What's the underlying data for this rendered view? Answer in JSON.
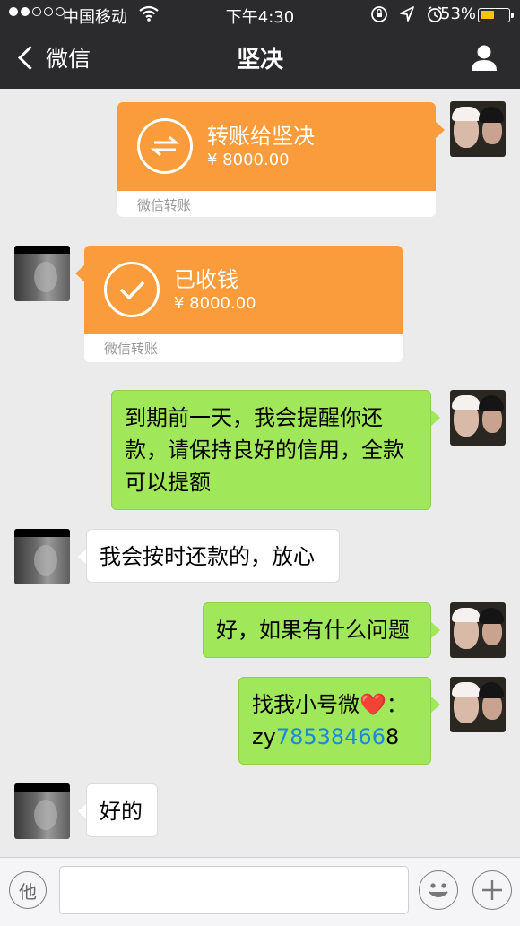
{
  "status_bar": {
    "carrier": "中国移动",
    "time": "下午4:30",
    "battery_percent": "53%",
    "battery_level": 0.53,
    "battery_color": "#f5c400"
  },
  "nav": {
    "back_label": "微信",
    "title": "坚决",
    "icons": [
      "chevron-left-icon",
      "person-icon"
    ]
  },
  "messages": [
    {
      "side": "right",
      "type": "transfer",
      "title": "转账给坚决",
      "amount": "¥ 8000.00",
      "footer": "微信转账",
      "icon": "transfer-arrows-icon"
    },
    {
      "side": "left",
      "type": "transfer",
      "title": "已收钱",
      "amount": "¥ 8000.00",
      "footer": "微信转账",
      "icon": "check-icon"
    },
    {
      "side": "right",
      "type": "text",
      "lines": [
        "到期前一天，我会提醒你还",
        "款，请保持良好的信用，全款",
        "可以提额"
      ]
    },
    {
      "side": "left",
      "type": "text",
      "text": "我会按时还款的，放心"
    },
    {
      "side": "right",
      "type": "text",
      "text": "好，如果有什么问题"
    },
    {
      "side": "right",
      "type": "text",
      "line1": "找我小号微",
      "emoji": "❤️",
      "line1_end": "：",
      "line2_prefix": "zy",
      "line2_link": "78538466",
      "line2_suffix": "8"
    },
    {
      "side": "left",
      "type": "text",
      "text": "好的"
    }
  ],
  "input_bar": {
    "voice_label": "他",
    "icons": [
      "smiley-icon",
      "plus-icon"
    ]
  },
  "colors": {
    "nav_bg": "#2b2b2e",
    "chat_bg": "#ebebeb",
    "transfer_orange": "#fa9c3b",
    "bubble_green": "#a0e759",
    "link_blue": "#1a8ad6"
  }
}
